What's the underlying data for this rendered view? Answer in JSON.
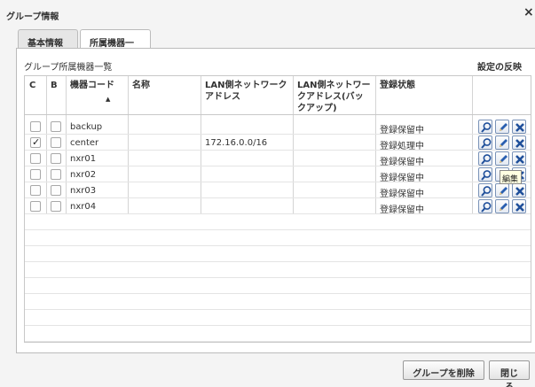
{
  "window": {
    "title": "グループ情報",
    "close_glyph": "×"
  },
  "tabs": [
    {
      "label": "基本情報",
      "active": false
    },
    {
      "label": "所属機器一覧",
      "active": true
    }
  ],
  "panel": {
    "title": "グループ所属機器一覧",
    "apply_label": "設定の反映"
  },
  "table": {
    "headers": [
      "C",
      "B",
      "機器コード",
      "名称",
      "LAN側ネットワークアドレス",
      "LAN側ネットワークアドレス(バックアップ)",
      "登録状態"
    ],
    "sort_indicator": "▲",
    "rows": [
      {
        "c": false,
        "b": false,
        "code": "backup",
        "name": "",
        "lan": "",
        "lan_backup": "",
        "status": "登録保留中"
      },
      {
        "c": true,
        "b": false,
        "code": "center",
        "name": "",
        "lan": "172.16.0.0/16",
        "lan_backup": "",
        "status": "登録処理中"
      },
      {
        "c": false,
        "b": false,
        "code": "nxr01",
        "name": "",
        "lan": "",
        "lan_backup": "",
        "status": "登録保留中"
      },
      {
        "c": false,
        "b": false,
        "code": "nxr02",
        "name": "",
        "lan": "",
        "lan_backup": "",
        "status": "登録保留中"
      },
      {
        "c": false,
        "b": false,
        "code": "nxr03",
        "name": "",
        "lan": "",
        "lan_backup": "",
        "status": "登録保留中"
      },
      {
        "c": false,
        "b": false,
        "code": "nxr04",
        "name": "",
        "lan": "",
        "lan_backup": "",
        "status": "登録保留中"
      }
    ],
    "action_icons": [
      "search-icon",
      "edit-pencil-icon",
      "delete-x-icon"
    ]
  },
  "tooltip": {
    "text": "編集"
  },
  "footer": {
    "delete_group_label": "グループを削除",
    "close_label": "閉じる"
  },
  "colors": {
    "action_border": "#7a93b8",
    "delete_blue": "#1f4f9a",
    "pencil_blue": "#2a5fb0"
  }
}
